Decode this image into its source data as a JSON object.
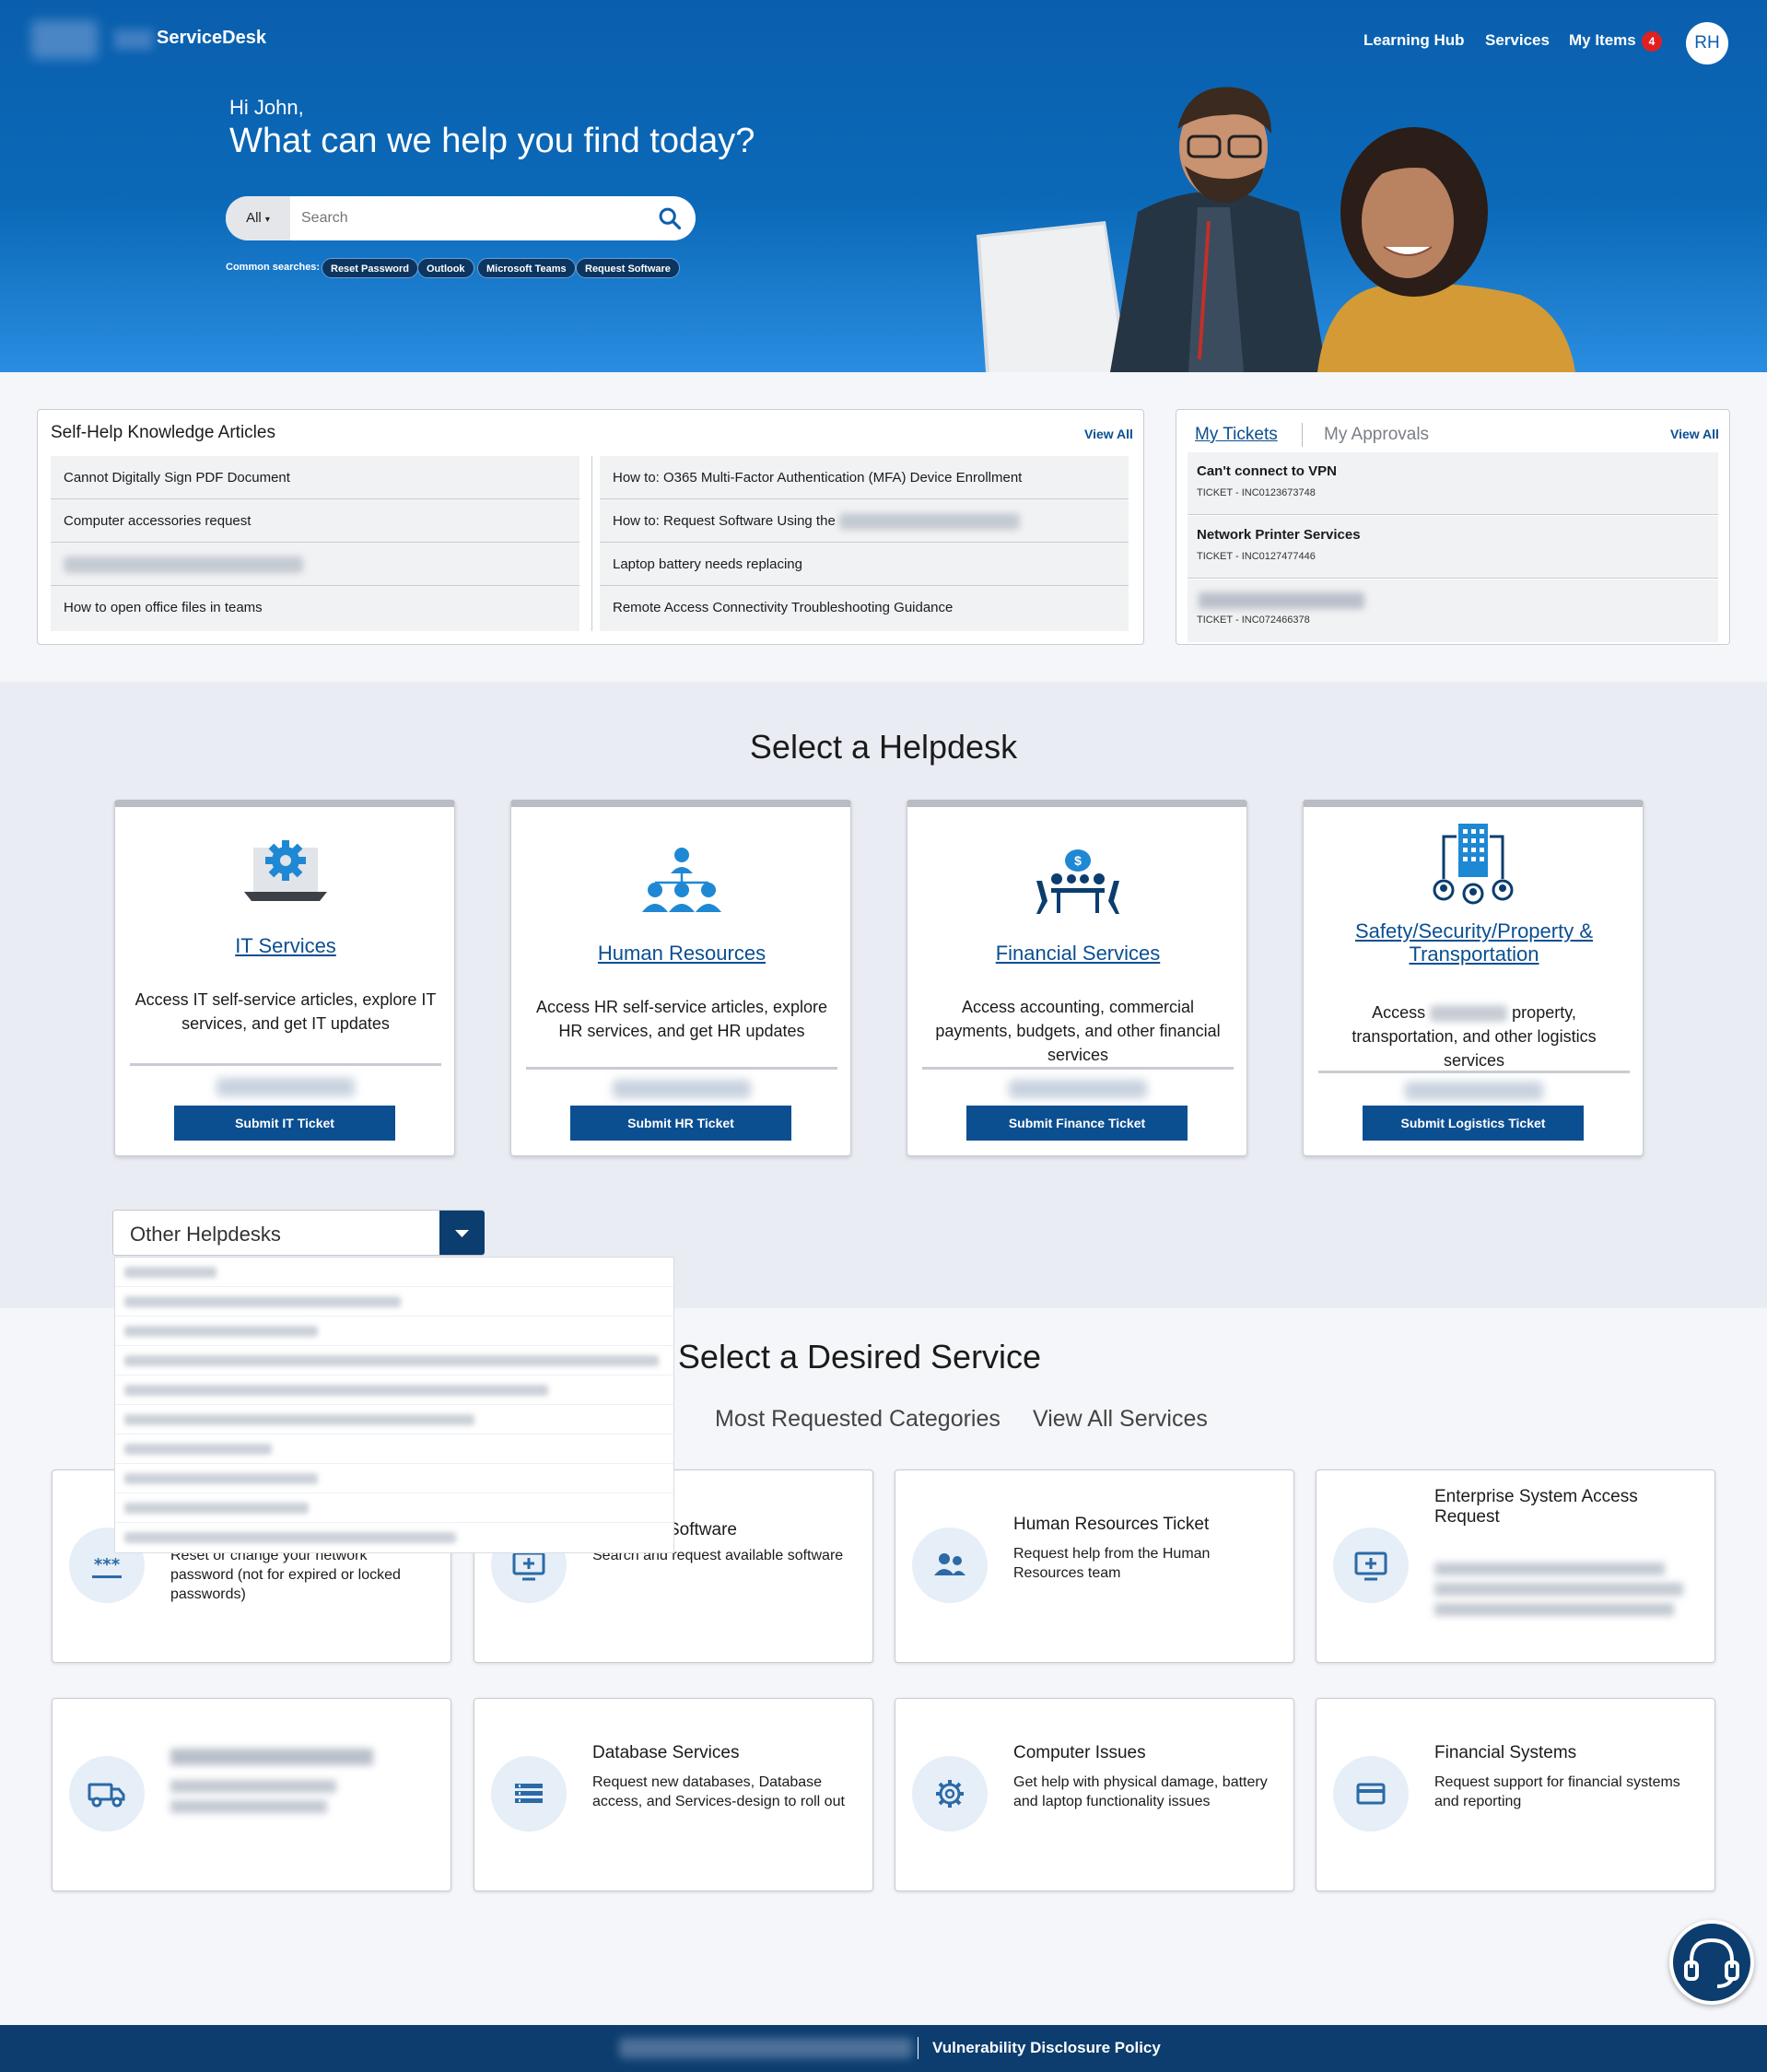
{
  "header": {
    "brand": "ServiceDesk",
    "nav": [
      "Learning Hub",
      "Services",
      "My Items"
    ],
    "my_items_count": "4",
    "avatar_initials": "RH"
  },
  "hero": {
    "greeting": "Hi John,",
    "headline": "What can we help you find today?",
    "search_scope": "All",
    "search_placeholder": "Search",
    "common_label": "Common searches:",
    "common_searches": [
      "Reset Password",
      "Outlook",
      "Microsoft Teams",
      "Request Software"
    ]
  },
  "knowledge": {
    "title": "Self-Help Knowledge Articles",
    "view_all": "View All",
    "left": [
      "Cannot Digitally Sign PDF Document",
      "Computer accessories request",
      "",
      "How to open office files in teams"
    ],
    "right": [
      "How to: O365 Multi-Factor Authentication (MFA) Device Enrollment",
      "How to: Request Software Using the",
      "Laptop battery needs replacing",
      "Remote Access Connectivity Troubleshooting Guidance"
    ]
  },
  "tickets": {
    "tab_active": "My Tickets",
    "tab_inactive": "My Approvals",
    "view_all": "View All",
    "items": [
      {
        "title": "Can't connect to VPN",
        "number": "TICKET - INC0123673748"
      },
      {
        "title": "Network Printer Services",
        "number": "TICKET - INC0127477446"
      },
      {
        "title": "",
        "number": "TICKET - INC072466378"
      }
    ]
  },
  "helpdesk": {
    "title": "Select a Helpdesk",
    "cards": [
      {
        "name": "IT Services",
        "desc": "Access IT self-service articles, explore IT services, and get IT updates",
        "button": "Submit IT Ticket"
      },
      {
        "name": "Human Resources",
        "desc": "Access HR self-service articles, explore HR services, and get HR updates",
        "button": "Submit HR Ticket"
      },
      {
        "name": "Financial Services",
        "desc": "Access accounting, commercial payments, budgets, and other financial services",
        "button": "Submit Finance Ticket"
      },
      {
        "name": "Safety/Security/Property & Transportation",
        "desc_a": "Access",
        "desc_b": "property, transportation, and other logistics services",
        "button": "Submit Logistics Ticket"
      }
    ],
    "other_label": "Other Helpdesks"
  },
  "services": {
    "title": "Select a Desired Service",
    "tabs": [
      "Most Requested Categories",
      "View All Services"
    ],
    "cards": [
      {
        "name": "",
        "desc": "Reset or change your network password (not for expired or locked passwords)",
        "icon": "password-icon"
      },
      {
        "name": "Software",
        "desc": "Search and request available software",
        "icon": "monitor-plus-icon"
      },
      {
        "name": "Human Resources Ticket",
        "desc": "Request help from the Human Resources team",
        "icon": "people-icon"
      },
      {
        "name": "Enterprise System Access Request",
        "desc": "",
        "icon": "monitor-plus-icon"
      },
      {
        "name": "",
        "desc": "",
        "icon": "truck-icon"
      },
      {
        "name": "Database Services",
        "desc": "Request new databases, Database access, and Services-design to roll out",
        "icon": "list-icon"
      },
      {
        "name": "Computer Issues",
        "desc": "Get help with physical damage, battery and laptop functionality issues",
        "icon": "gear-icon"
      },
      {
        "name": "Financial Systems",
        "desc": "Request support for financial systems and reporting",
        "icon": "card-icon"
      }
    ]
  },
  "footer": {
    "link": "Vulnerability Disclosure Policy"
  },
  "colors": {
    "primary": "#0b4f91",
    "hero": "#0b66b5",
    "footer": "#0c3d6e",
    "badge": "#e02020"
  }
}
